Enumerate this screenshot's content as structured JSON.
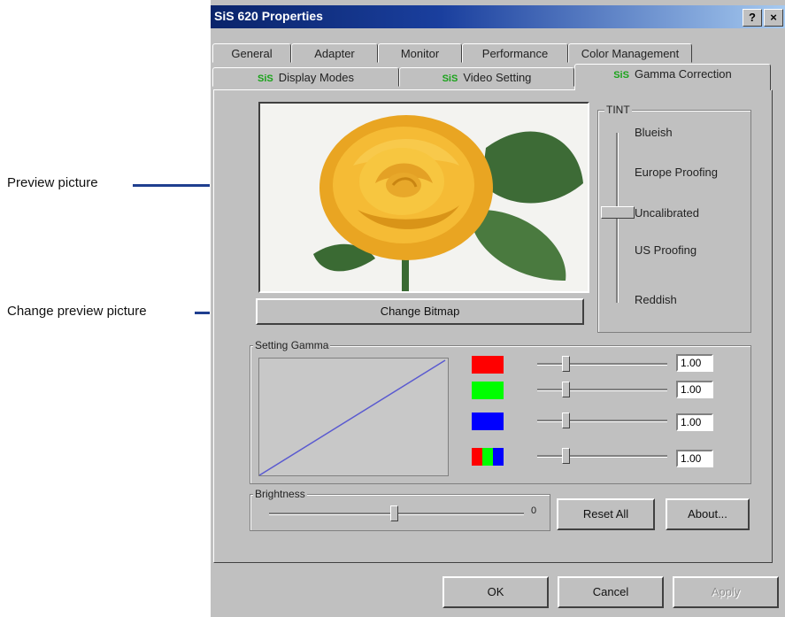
{
  "callouts": {
    "preview_picture": "Preview picture",
    "change_preview_picture": "Change preview picture"
  },
  "window": {
    "title": "SiS 620 Properties",
    "help_label": "?",
    "close_label": "×"
  },
  "tabs_row1": [
    "General",
    "Adapter",
    "Monitor",
    "Performance",
    "Color Management"
  ],
  "tabs_row2": [
    "Display Modes",
    "Video Setting",
    "Gamma Correction"
  ],
  "tab_icon_text": "SiS",
  "active_tab": "Gamma Correction",
  "tint": {
    "label": "TINT",
    "options": [
      "Blueish",
      "Europe Proofing",
      "Uncalibrated",
      "US Proofing",
      "Reddish"
    ],
    "selected": "Uncalibrated"
  },
  "change_bitmap_label": "Change Bitmap",
  "setting_gamma": {
    "label": "Setting Gamma",
    "channels": [
      {
        "color": "#ff0000",
        "value": "1.00"
      },
      {
        "color": "#00ff00",
        "value": "1.00"
      },
      {
        "color": "#0000ff",
        "value": "1.00"
      },
      {
        "color": "rgb",
        "value": "1.00"
      }
    ]
  },
  "brightness": {
    "label": "Brightness",
    "value": "0"
  },
  "buttons": {
    "reset_all": "Reset All",
    "about": "About...",
    "ok": "OK",
    "cancel": "Cancel",
    "apply": "Apply"
  },
  "colors": {
    "title_bar": "#0a246a",
    "dialog_face": "#c0c0c0",
    "callout_line": "#1f3f8f",
    "gamma_curve": "#5a5ad0"
  }
}
